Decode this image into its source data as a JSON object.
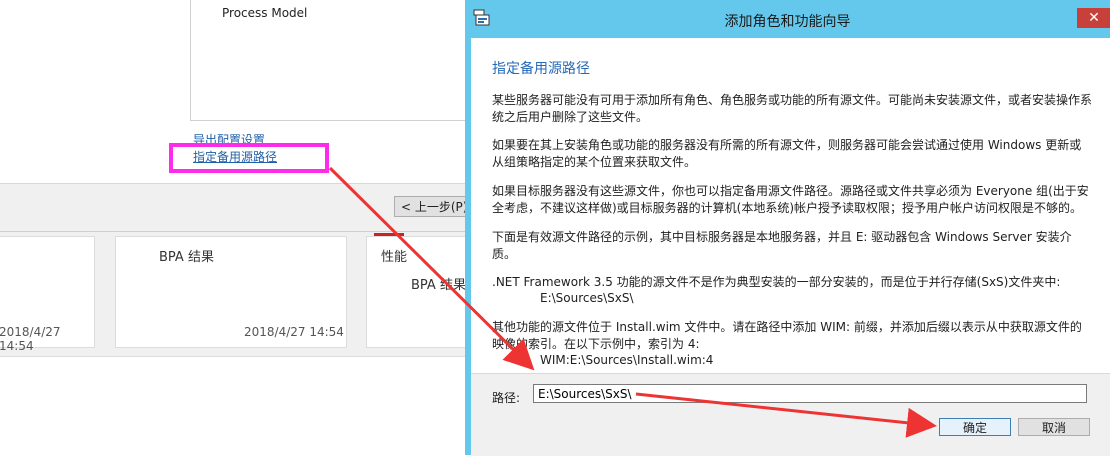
{
  "background_wizard": {
    "list_item": "Process Model",
    "link_export": "导出配置设置",
    "link_alternate_source": "指定备用源路径",
    "prev_button": "< 上一步(P)",
    "tiles": [
      {
        "title": "",
        "date": "2018/4/27 14:54"
      },
      {
        "title": "BPA 结果",
        "date": "2018/4/27 14:54"
      },
      {
        "title": "性能",
        "subtitle": "BPA 结果"
      }
    ]
  },
  "dialog": {
    "title": "添加角色和功能向导",
    "close_label": "✕",
    "heading": "指定备用源路径",
    "paragraphs": [
      "某些服务器可能没有可用于添加所有角色、角色服务或功能的所有源文件。可能尚未安装源文件，或者安装操作系统之后用户删除了这些文件。",
      "如果要在其上安装角色或功能的服务器没有所需的所有源文件，则服务器可能会尝试通过使用 Windows 更新或从组策略指定的某个位置来获取文件。",
      "如果目标服务器没有这些源文件，你也可以指定备用源文件路径。源路径或文件共享必须为 Everyone 组(出于安全考虑，不建议这样做)或目标服务器的计算机(本地系统)帐户授予读取权限；授予用户帐户访问权限是不够的。",
      "下面是有效源文件路径的示例，其中目标服务器是本地服务器，并且 E: 驱动器包含 Windows Server 安装介质。",
      ".NET Framework 3.5 功能的源文件不是作为典型安装的一部分安装的，而是位于并行存储(SxS)文件夹中:",
      "其他功能的源文件位于 Install.wim 文件中。请在路径中添加 WIM: 前缀，并添加后缀以表示从中获取源文件的映像的索引。在以下示例中，索引为 4:"
    ],
    "example_sxs": "E:\\Sources\\SxS\\",
    "example_wim": "WIM:E:\\Sources\\Install.wim:4",
    "path_label": "路径:",
    "path_value": "E:\\Sources\\SxS\\",
    "ok_label": "确定",
    "cancel_label": "取消"
  },
  "colors": {
    "dialog_frame": "#64c8ec",
    "heading": "#2469b8",
    "highlight": "#ff2bea",
    "arrow": "#ee3333",
    "close_button": "#c7413a"
  }
}
